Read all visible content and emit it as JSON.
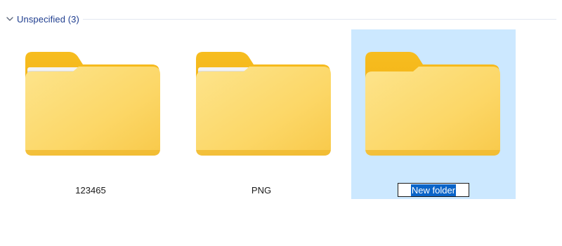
{
  "group": {
    "label": "Unspecified (3)",
    "icon": "chevron-down-icon"
  },
  "items": [
    {
      "name": "123465",
      "icon": "folder-with-documents-icon",
      "selected": false
    },
    {
      "name": "PNG",
      "icon": "folder-with-documents-icon",
      "selected": false
    },
    {
      "name": "New folder",
      "icon": "folder-icon",
      "selected": true,
      "renaming": true
    }
  ],
  "colors": {
    "group_label": "#1e3d8f",
    "selection_background": "#cce8ff",
    "text_highlight": "#0a64c8",
    "folder_back": "#f2b416",
    "folder_front": "#fcd867"
  }
}
